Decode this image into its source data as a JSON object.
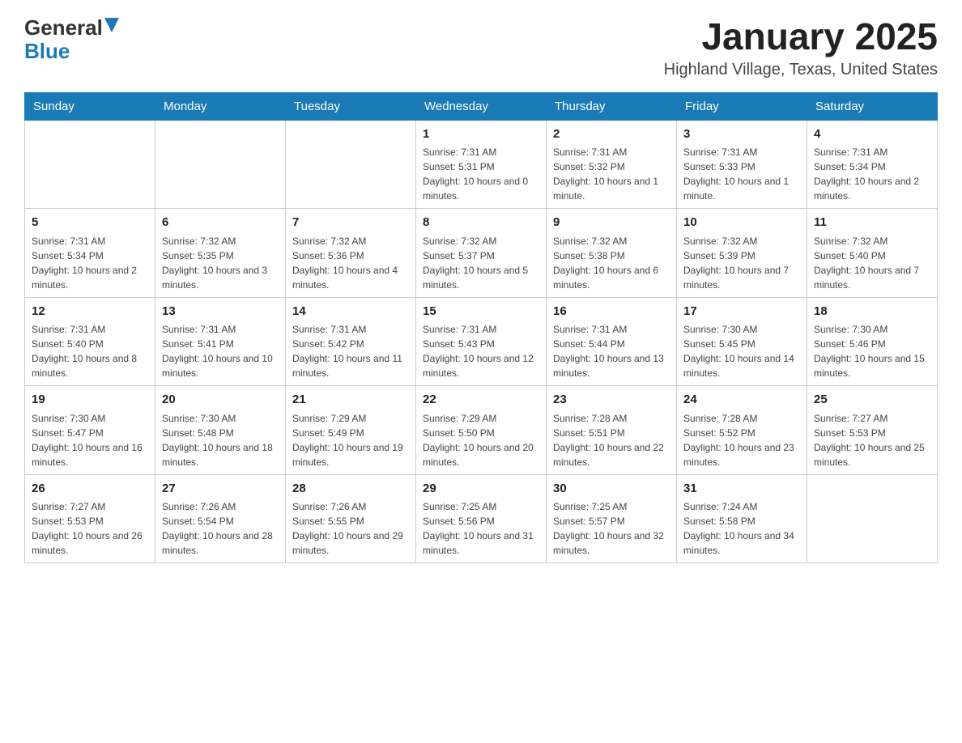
{
  "header": {
    "logo_general": "General",
    "logo_blue": "Blue",
    "title": "January 2025",
    "subtitle": "Highland Village, Texas, United States"
  },
  "calendar": {
    "days_of_week": [
      "Sunday",
      "Monday",
      "Tuesday",
      "Wednesday",
      "Thursday",
      "Friday",
      "Saturday"
    ],
    "weeks": [
      [
        {
          "day": "",
          "info": ""
        },
        {
          "day": "",
          "info": ""
        },
        {
          "day": "",
          "info": ""
        },
        {
          "day": "1",
          "info": "Sunrise: 7:31 AM\nSunset: 5:31 PM\nDaylight: 10 hours and 0 minutes."
        },
        {
          "day": "2",
          "info": "Sunrise: 7:31 AM\nSunset: 5:32 PM\nDaylight: 10 hours and 1 minute."
        },
        {
          "day": "3",
          "info": "Sunrise: 7:31 AM\nSunset: 5:33 PM\nDaylight: 10 hours and 1 minute."
        },
        {
          "day": "4",
          "info": "Sunrise: 7:31 AM\nSunset: 5:34 PM\nDaylight: 10 hours and 2 minutes."
        }
      ],
      [
        {
          "day": "5",
          "info": "Sunrise: 7:31 AM\nSunset: 5:34 PM\nDaylight: 10 hours and 2 minutes."
        },
        {
          "day": "6",
          "info": "Sunrise: 7:32 AM\nSunset: 5:35 PM\nDaylight: 10 hours and 3 minutes."
        },
        {
          "day": "7",
          "info": "Sunrise: 7:32 AM\nSunset: 5:36 PM\nDaylight: 10 hours and 4 minutes."
        },
        {
          "day": "8",
          "info": "Sunrise: 7:32 AM\nSunset: 5:37 PM\nDaylight: 10 hours and 5 minutes."
        },
        {
          "day": "9",
          "info": "Sunrise: 7:32 AM\nSunset: 5:38 PM\nDaylight: 10 hours and 6 minutes."
        },
        {
          "day": "10",
          "info": "Sunrise: 7:32 AM\nSunset: 5:39 PM\nDaylight: 10 hours and 7 minutes."
        },
        {
          "day": "11",
          "info": "Sunrise: 7:32 AM\nSunset: 5:40 PM\nDaylight: 10 hours and 7 minutes."
        }
      ],
      [
        {
          "day": "12",
          "info": "Sunrise: 7:31 AM\nSunset: 5:40 PM\nDaylight: 10 hours and 8 minutes."
        },
        {
          "day": "13",
          "info": "Sunrise: 7:31 AM\nSunset: 5:41 PM\nDaylight: 10 hours and 10 minutes."
        },
        {
          "day": "14",
          "info": "Sunrise: 7:31 AM\nSunset: 5:42 PM\nDaylight: 10 hours and 11 minutes."
        },
        {
          "day": "15",
          "info": "Sunrise: 7:31 AM\nSunset: 5:43 PM\nDaylight: 10 hours and 12 minutes."
        },
        {
          "day": "16",
          "info": "Sunrise: 7:31 AM\nSunset: 5:44 PM\nDaylight: 10 hours and 13 minutes."
        },
        {
          "day": "17",
          "info": "Sunrise: 7:30 AM\nSunset: 5:45 PM\nDaylight: 10 hours and 14 minutes."
        },
        {
          "day": "18",
          "info": "Sunrise: 7:30 AM\nSunset: 5:46 PM\nDaylight: 10 hours and 15 minutes."
        }
      ],
      [
        {
          "day": "19",
          "info": "Sunrise: 7:30 AM\nSunset: 5:47 PM\nDaylight: 10 hours and 16 minutes."
        },
        {
          "day": "20",
          "info": "Sunrise: 7:30 AM\nSunset: 5:48 PM\nDaylight: 10 hours and 18 minutes."
        },
        {
          "day": "21",
          "info": "Sunrise: 7:29 AM\nSunset: 5:49 PM\nDaylight: 10 hours and 19 minutes."
        },
        {
          "day": "22",
          "info": "Sunrise: 7:29 AM\nSunset: 5:50 PM\nDaylight: 10 hours and 20 minutes."
        },
        {
          "day": "23",
          "info": "Sunrise: 7:28 AM\nSunset: 5:51 PM\nDaylight: 10 hours and 22 minutes."
        },
        {
          "day": "24",
          "info": "Sunrise: 7:28 AM\nSunset: 5:52 PM\nDaylight: 10 hours and 23 minutes."
        },
        {
          "day": "25",
          "info": "Sunrise: 7:27 AM\nSunset: 5:53 PM\nDaylight: 10 hours and 25 minutes."
        }
      ],
      [
        {
          "day": "26",
          "info": "Sunrise: 7:27 AM\nSunset: 5:53 PM\nDaylight: 10 hours and 26 minutes."
        },
        {
          "day": "27",
          "info": "Sunrise: 7:26 AM\nSunset: 5:54 PM\nDaylight: 10 hours and 28 minutes."
        },
        {
          "day": "28",
          "info": "Sunrise: 7:26 AM\nSunset: 5:55 PM\nDaylight: 10 hours and 29 minutes."
        },
        {
          "day": "29",
          "info": "Sunrise: 7:25 AM\nSunset: 5:56 PM\nDaylight: 10 hours and 31 minutes."
        },
        {
          "day": "30",
          "info": "Sunrise: 7:25 AM\nSunset: 5:57 PM\nDaylight: 10 hours and 32 minutes."
        },
        {
          "day": "31",
          "info": "Sunrise: 7:24 AM\nSunset: 5:58 PM\nDaylight: 10 hours and 34 minutes."
        },
        {
          "day": "",
          "info": ""
        }
      ]
    ]
  }
}
